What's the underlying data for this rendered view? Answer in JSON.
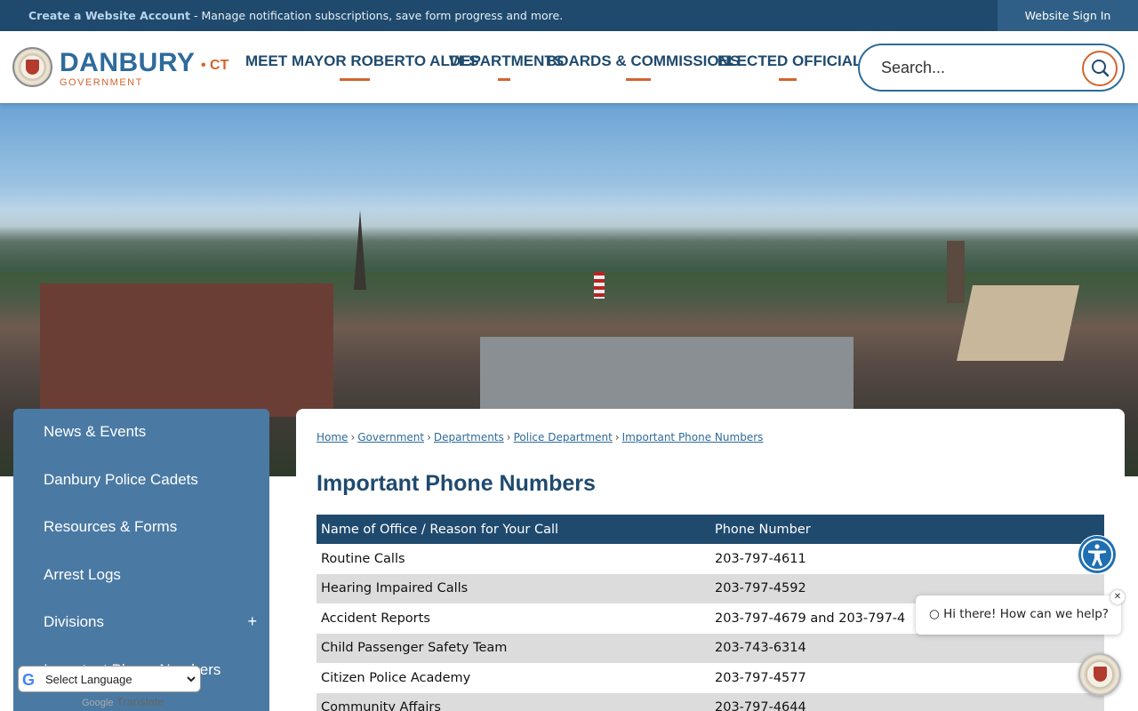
{
  "topbar": {
    "create_account": "Create a Website Account",
    "message": " - Manage notification subscriptions, save form progress and more.",
    "sign_in": "Website Sign In"
  },
  "brand": {
    "name": "DANBURY",
    "sub": "GOVERNMENT",
    "state": "• CT"
  },
  "nav": [
    {
      "label": "MEET MAYOR ROBERTO ALVES"
    },
    {
      "label": "DEPARTMENTS"
    },
    {
      "label": "BOARDS & COMMISSIONS"
    },
    {
      "label": "ELECTED OFFICIALS"
    }
  ],
  "search": {
    "placeholder": "Search..."
  },
  "sidenav": {
    "items": [
      {
        "label": "News & Events"
      },
      {
        "label": "Danbury Police Cadets"
      },
      {
        "label": "Resources & Forms"
      },
      {
        "label": "Arrest Logs"
      },
      {
        "label": "Divisions",
        "expand": "+"
      },
      {
        "label": "Important Phone Numbers"
      }
    ]
  },
  "breadcrumb": [
    "Home",
    "Government",
    "Departments",
    "Police Department",
    "Important Phone Numbers"
  ],
  "breadcrumb_sep": "›",
  "page_title": "Important Phone Numbers",
  "table": {
    "headers": [
      "Name of Office / Reason for Your Call",
      "Phone Number"
    ],
    "rows": [
      [
        "Routine Calls",
        "203-797-4611"
      ],
      [
        "Hearing Impaired Calls",
        "203-797-4592"
      ],
      [
        "Accident Reports",
        "203-797-4679 and 203-797-4"
      ],
      [
        "Child Passenger Safety Team",
        "203-743-6314"
      ],
      [
        "Citizen Police Academy",
        "203-797-4577"
      ],
      [
        "Community Affairs",
        "203-797-4644"
      ]
    ]
  },
  "chat": {
    "greeting": "Hi there! How can we help?",
    "close": "✕"
  },
  "translate": {
    "select_label": "Select Language",
    "powered_by": "Google",
    "translate_label": "Translate"
  },
  "colors": {
    "primary": "#1f4a6e",
    "accent": "#d3642e",
    "sidenav": "#4a7aa3"
  },
  "icons": {
    "search": "search-icon",
    "accessibility": "accessibility-icon",
    "chat": "chat-icon",
    "google": "google-logo-icon"
  }
}
